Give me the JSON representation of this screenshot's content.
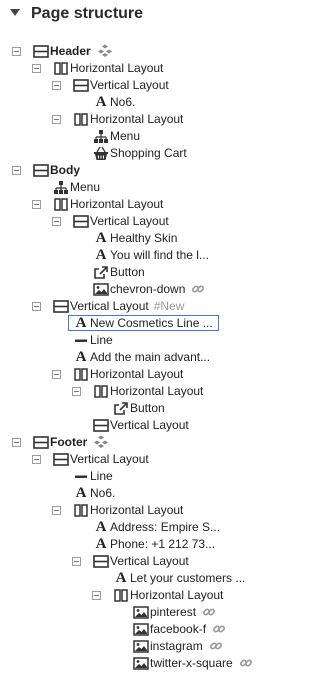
{
  "panel": {
    "title": "Page structure"
  },
  "tree": [
    {
      "level": 0,
      "toggle": true,
      "icon": "rows",
      "label": "Header",
      "bold": true,
      "side": "components-icon"
    },
    {
      "level": 1,
      "toggle": true,
      "icon": "columns",
      "label": "Horizontal Layout"
    },
    {
      "level": 2,
      "toggle": true,
      "icon": "rows",
      "label": "Vertical Layout"
    },
    {
      "level": 3,
      "toggle": false,
      "icon": "text",
      "label": "No6."
    },
    {
      "level": 2,
      "toggle": true,
      "icon": "columns",
      "label": "Horizontal Layout"
    },
    {
      "level": 3,
      "toggle": false,
      "icon": "sitemap",
      "label": "Menu"
    },
    {
      "level": 3,
      "toggle": false,
      "icon": "basket",
      "label": "Shopping Cart"
    },
    {
      "level": 0,
      "toggle": true,
      "icon": "rows",
      "label": "Body",
      "bold": true
    },
    {
      "level": 1,
      "toggle": false,
      "icon": "sitemap",
      "label": "Menu"
    },
    {
      "level": 1,
      "toggle": true,
      "icon": "columns",
      "label": "Horizontal Layout"
    },
    {
      "level": 2,
      "toggle": true,
      "icon": "rows",
      "label": "Vertical Layout"
    },
    {
      "level": 3,
      "toggle": false,
      "icon": "text",
      "label": "Healthy Skin"
    },
    {
      "level": 3,
      "toggle": false,
      "icon": "text",
      "label": "You will find the l..."
    },
    {
      "level": 3,
      "toggle": false,
      "icon": "external",
      "label": "Button"
    },
    {
      "level": 3,
      "toggle": false,
      "icon": "image",
      "label": "chevron-down",
      "side": "link-icon"
    },
    {
      "level": 1,
      "toggle": true,
      "icon": "rows",
      "label": "Vertical Layout",
      "tag": "#New"
    },
    {
      "level": 2,
      "toggle": false,
      "icon": "text",
      "label": "New Cosmetics Line ...",
      "selected": true
    },
    {
      "level": 2,
      "toggle": false,
      "icon": "line",
      "label": "Line"
    },
    {
      "level": 2,
      "toggle": false,
      "icon": "text",
      "label": "Add the main advant..."
    },
    {
      "level": 2,
      "toggle": true,
      "icon": "columns",
      "label": "Horizontal Layout"
    },
    {
      "level": 3,
      "toggle": true,
      "icon": "columns",
      "label": "Horizontal Layout"
    },
    {
      "level": 4,
      "toggle": false,
      "icon": "external",
      "label": "Button"
    },
    {
      "level": 3,
      "toggle": false,
      "icon": "rows",
      "label": "Vertical Layout"
    },
    {
      "level": 0,
      "toggle": true,
      "icon": "rows",
      "label": "Footer",
      "bold": true,
      "side": "components-icon"
    },
    {
      "level": 1,
      "toggle": true,
      "icon": "rows",
      "label": "Vertical Layout"
    },
    {
      "level": 2,
      "toggle": false,
      "icon": "line",
      "label": "Line"
    },
    {
      "level": 2,
      "toggle": false,
      "icon": "text",
      "label": "No6."
    },
    {
      "level": 2,
      "toggle": true,
      "icon": "columns",
      "label": "Horizontal Layout"
    },
    {
      "level": 3,
      "toggle": false,
      "icon": "text",
      "label": "Address: Empire S..."
    },
    {
      "level": 3,
      "toggle": false,
      "icon": "text",
      "label": "Phone: +1 212 73..."
    },
    {
      "level": 3,
      "toggle": true,
      "icon": "rows",
      "label": "Vertical Layout"
    },
    {
      "level": 4,
      "toggle": false,
      "icon": "text",
      "label": "Let your customers ..."
    },
    {
      "level": 4,
      "toggle": true,
      "icon": "columns",
      "label": "Horizontal Layout"
    },
    {
      "level": 5,
      "toggle": false,
      "icon": "image",
      "label": "pinterest",
      "side": "link-icon"
    },
    {
      "level": 5,
      "toggle": false,
      "icon": "image",
      "label": "facebook-f",
      "side": "link-icon"
    },
    {
      "level": 5,
      "toggle": false,
      "icon": "image",
      "label": "instagram",
      "side": "link-icon"
    },
    {
      "level": 5,
      "toggle": false,
      "icon": "image",
      "label": "twitter-x-square",
      "side": "link-icon"
    }
  ],
  "colors": {
    "selection_border": "#3d79d4",
    "tag_text": "#9a9a9a",
    "icon": "#333333"
  }
}
